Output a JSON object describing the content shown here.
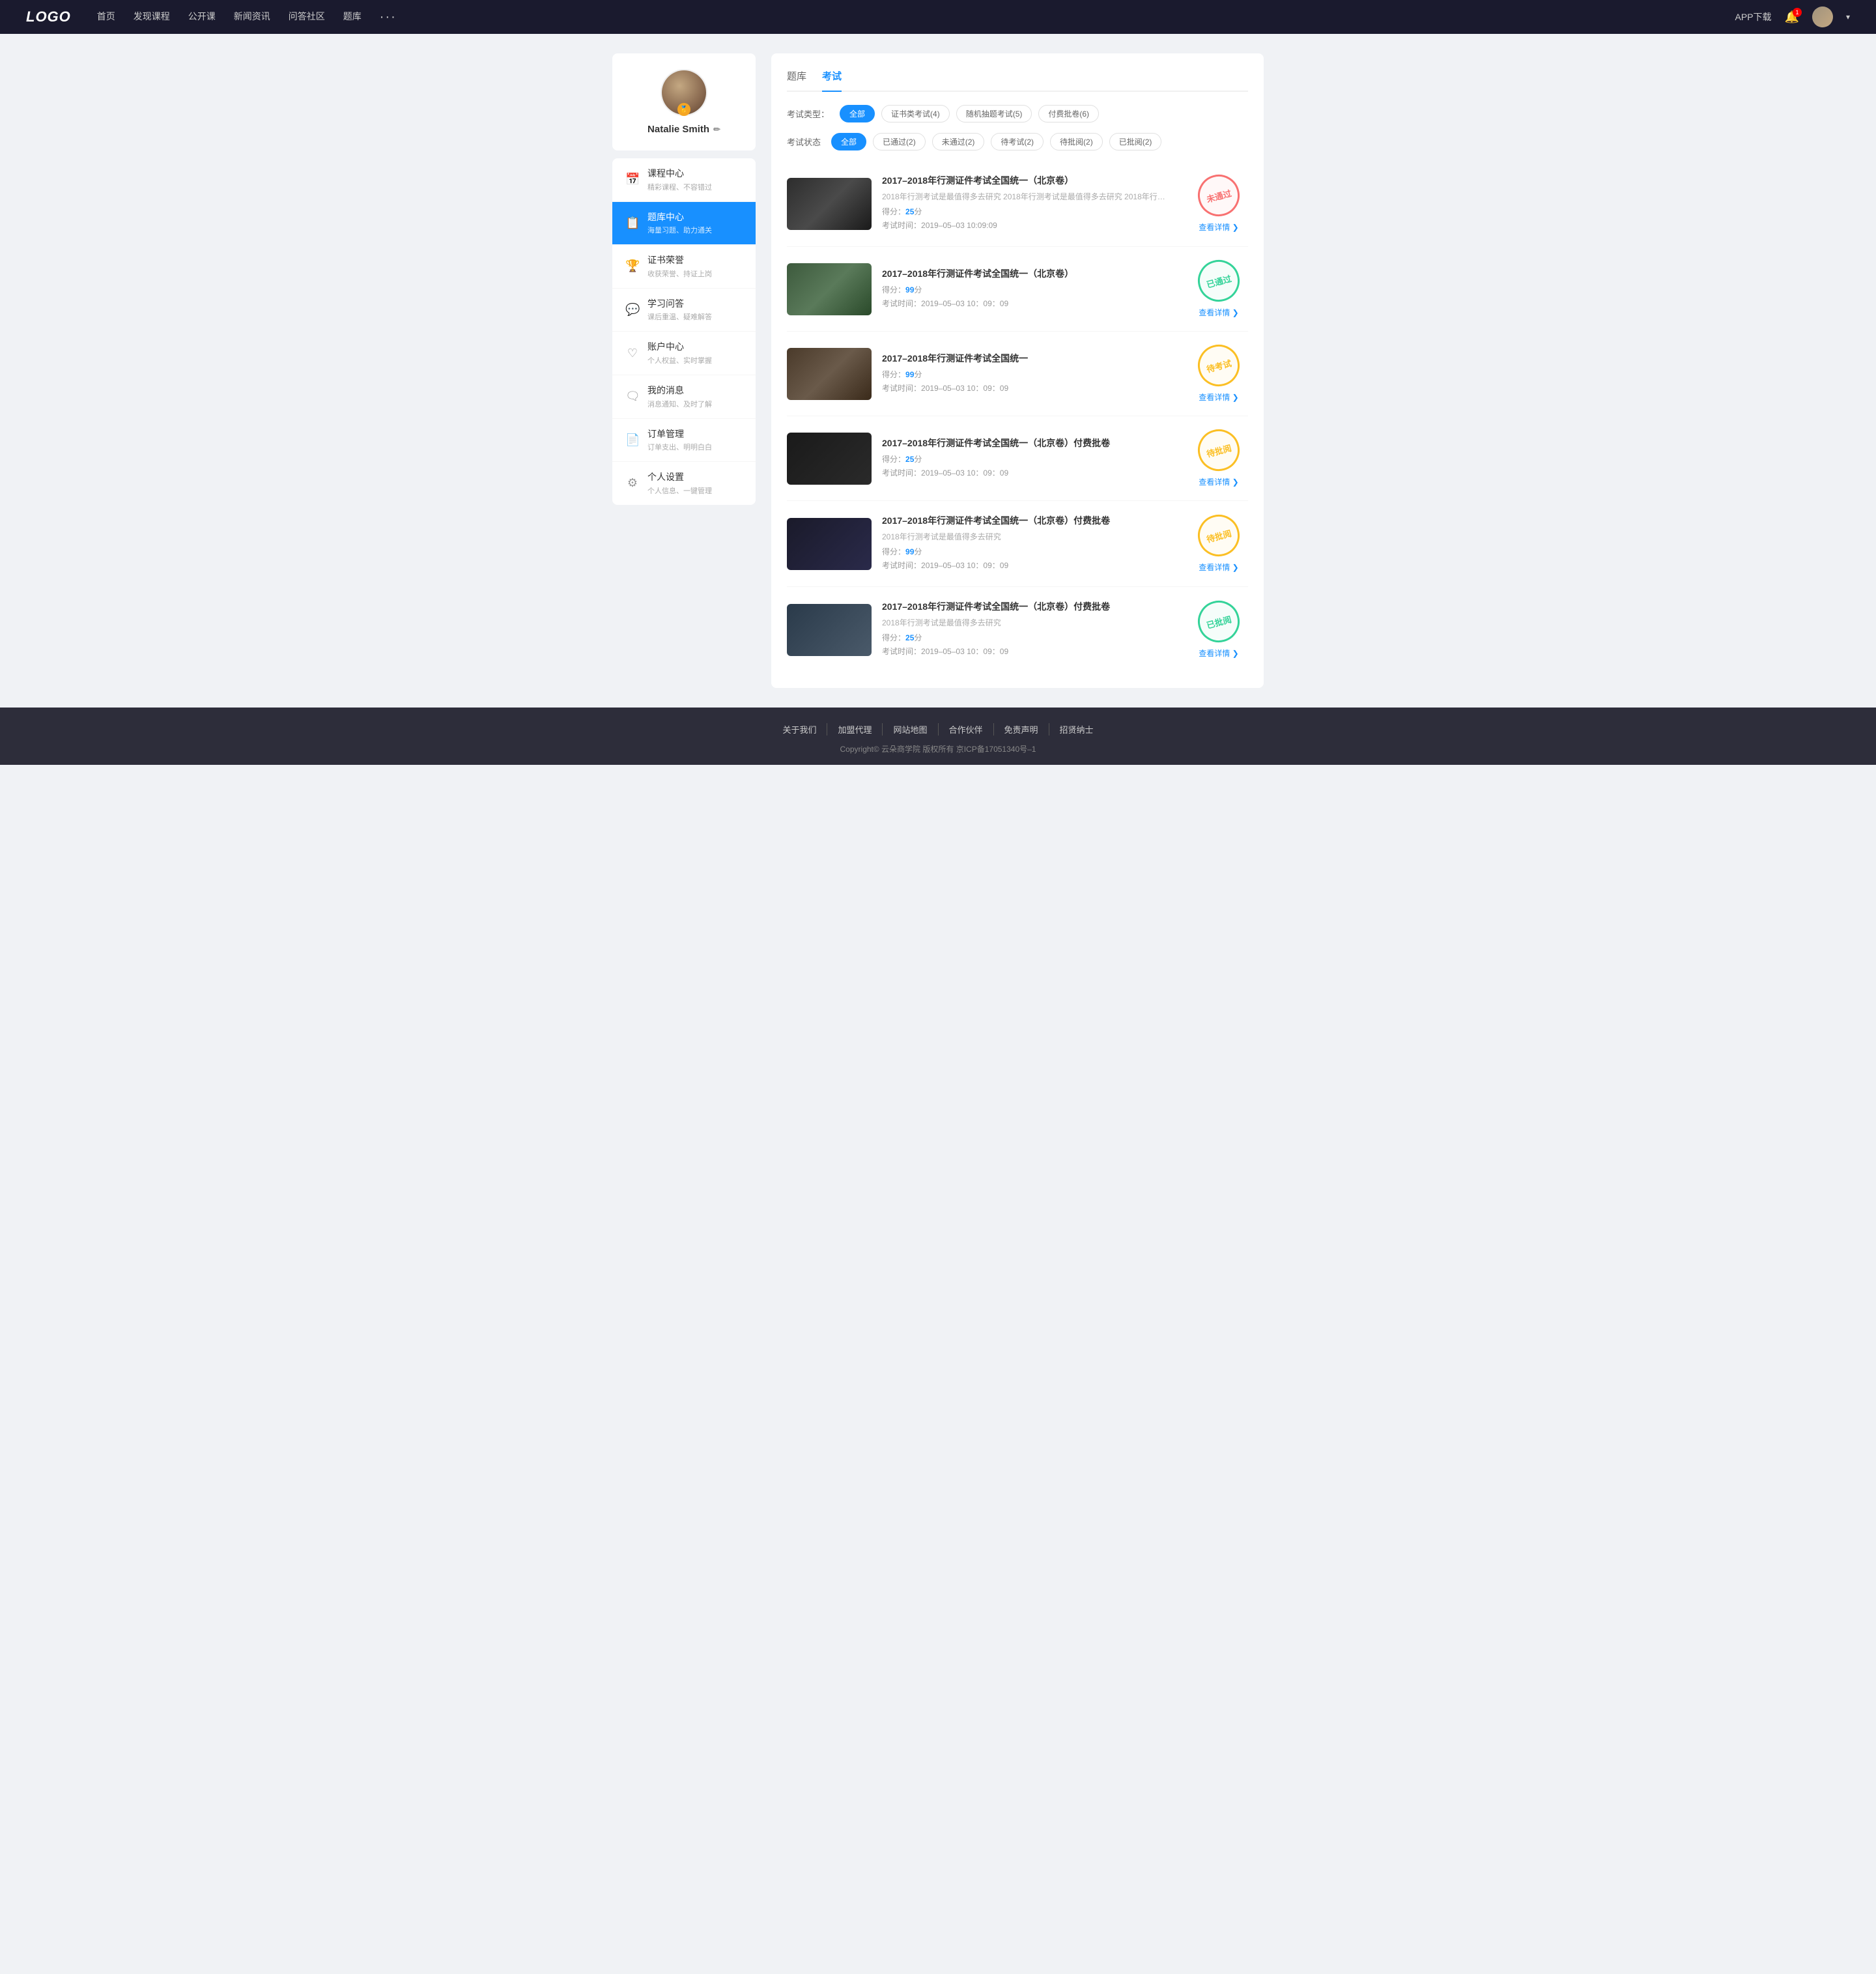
{
  "navbar": {
    "logo": "LOGO",
    "nav_items": [
      "首页",
      "发现课程",
      "公开课",
      "新闻资讯",
      "问答社区",
      "题库"
    ],
    "more_label": "···",
    "app_label": "APP下载",
    "bell_count": "1",
    "chevron": "▾"
  },
  "sidebar": {
    "profile": {
      "name": "Natalie Smith",
      "edit_icon": "✏",
      "badge": "🏅"
    },
    "menu_items": [
      {
        "icon": "📅",
        "title": "课程中心",
        "sub": "精彩课程、不容错过",
        "active": false
      },
      {
        "icon": "📋",
        "title": "题库中心",
        "sub": "海量习题、助力通关",
        "active": true
      },
      {
        "icon": "🏆",
        "title": "证书荣誉",
        "sub": "收获荣誉、持证上岗",
        "active": false
      },
      {
        "icon": "💬",
        "title": "学习问答",
        "sub": "课后重温、疑难解答",
        "active": false
      },
      {
        "icon": "♡",
        "title": "账户中心",
        "sub": "个人权益、实时掌握",
        "active": false
      },
      {
        "icon": "🗨",
        "title": "我的消息",
        "sub": "消息通知、及时了解",
        "active": false
      },
      {
        "icon": "📄",
        "title": "订单管理",
        "sub": "订单支出、明明白白",
        "active": false
      },
      {
        "icon": "⚙",
        "title": "个人设置",
        "sub": "个人信息、一键管理",
        "active": false
      }
    ]
  },
  "content": {
    "tabs": [
      "题库",
      "考试"
    ],
    "active_tab": 1,
    "exam_type_label": "考试类型：",
    "exam_type_filters": [
      {
        "label": "全部",
        "active": true
      },
      {
        "label": "证书类考试(4)",
        "active": false
      },
      {
        "label": "随机抽题考试(5)",
        "active": false
      },
      {
        "label": "付费批卷(6)",
        "active": false
      }
    ],
    "exam_status_label": "考试状态",
    "exam_status_filters": [
      {
        "label": "全部",
        "active": true
      },
      {
        "label": "已通过(2)",
        "active": false
      },
      {
        "label": "未通过(2)",
        "active": false
      },
      {
        "label": "待考试(2)",
        "active": false
      },
      {
        "label": "待批阅(2)",
        "active": false
      },
      {
        "label": "已批阅(2)",
        "active": false
      }
    ],
    "exams": [
      {
        "id": 1,
        "title": "2017–2018年行测证件考试全国统一（北京卷）",
        "desc": "2018年行测考试是最值得多去研究  2018年行测考试是最值得多去研究  2018年行…",
        "score_label": "得分：",
        "score": "25",
        "score_unit": "分",
        "time_label": "考试时间：",
        "time": "2019–05–03  10:09:09",
        "stamp_text": "未通过",
        "stamp_type": "fail",
        "link": "查看详情",
        "thumb_class": "thumb-1"
      },
      {
        "id": 2,
        "title": "2017–2018年行测证件考试全国统一（北京卷）",
        "desc": "",
        "score_label": "得分：",
        "score": "99",
        "score_unit": "分",
        "time_label": "考试时间：",
        "time": "2019–05–03  10：09：09",
        "stamp_text": "已通过",
        "stamp_type": "pass",
        "link": "查看详情",
        "thumb_class": "thumb-2"
      },
      {
        "id": 3,
        "title": "2017–2018年行测证件考试全国统一",
        "desc": "",
        "score_label": "得分：",
        "score": "99",
        "score_unit": "分",
        "time_label": "考试时间：",
        "time": "2019–05–03  10：09：09",
        "stamp_text": "待考试",
        "stamp_type": "pending",
        "link": "查看详情",
        "thumb_class": "thumb-3"
      },
      {
        "id": 4,
        "title": "2017–2018年行测证件考试全国统一（北京卷）付费批卷",
        "desc": "",
        "score_label": "得分：",
        "score": "25",
        "score_unit": "分",
        "time_label": "考试时间：",
        "time": "2019–05–03  10：09：09",
        "stamp_text": "待批阅",
        "stamp_type": "review",
        "link": "查看详情",
        "thumb_class": "thumb-4"
      },
      {
        "id": 5,
        "title": "2017–2018年行测证件考试全国统一（北京卷）付费批卷",
        "desc": "2018年行测考试是最值得多去研究",
        "score_label": "得分：",
        "score": "99",
        "score_unit": "分",
        "time_label": "考试时间：",
        "time": "2019–05–03  10：09：09",
        "stamp_text": "待批阅",
        "stamp_type": "review",
        "link": "查看详情",
        "thumb_class": "thumb-5"
      },
      {
        "id": 6,
        "title": "2017–2018年行测证件考试全国统一（北京卷）付费批卷",
        "desc": "2018年行测考试是最值得多去研究",
        "score_label": "得分：",
        "score": "25",
        "score_unit": "分",
        "time_label": "考试时间：",
        "time": "2019–05–03  10：09：09",
        "stamp_text": "已批阅",
        "stamp_type": "reviewed",
        "link": "查看详情",
        "thumb_class": "thumb-6"
      }
    ]
  },
  "footer": {
    "links": [
      "关于我们",
      "加盟代理",
      "网站地图",
      "合作伙伴",
      "免责声明",
      "招贤纳士"
    ],
    "copyright": "Copyright©  云朵商学院  版权所有    京ICP备17051340号–1"
  }
}
